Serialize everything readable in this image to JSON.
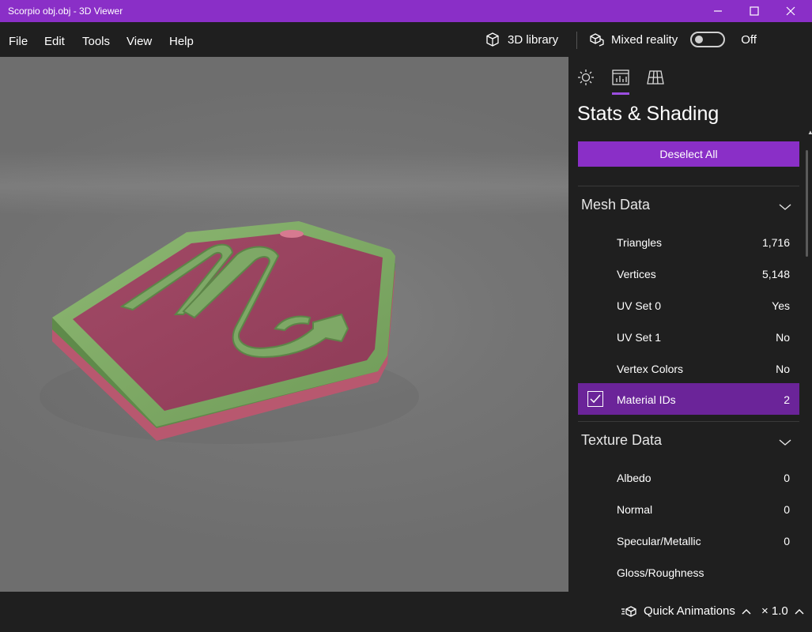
{
  "window": {
    "title": "Scorpio obj.obj - 3D Viewer",
    "accent_color": "#8a2fc7"
  },
  "menu": {
    "items": [
      {
        "label": "File"
      },
      {
        "label": "Edit"
      },
      {
        "label": "Tools"
      },
      {
        "label": "View"
      },
      {
        "label": "Help"
      }
    ],
    "library_label": "3D library",
    "library_icon": "cube-icon",
    "mixed_reality_label": "Mixed reality",
    "mixed_reality_icon": "mixed-reality-icon",
    "mixed_reality_state": "Off"
  },
  "viewport": {
    "model_name": "Scorpio obj.obj",
    "model_colors": {
      "frame": "#7da365",
      "plate": "#a04a66"
    }
  },
  "panel": {
    "tabs": [
      {
        "name": "lighting",
        "icon": "sun-icon",
        "active": false
      },
      {
        "name": "stats",
        "icon": "stats-chart-icon",
        "active": true
      },
      {
        "name": "grid",
        "icon": "grid-icon",
        "active": false
      }
    ],
    "title": "Stats & Shading",
    "deselect_label": "Deselect All",
    "mesh": {
      "heading": "Mesh Data",
      "rows": [
        {
          "label": "Triangles",
          "value": "1,716"
        },
        {
          "label": "Vertices",
          "value": "5,148"
        },
        {
          "label": "UV Set 0",
          "value": "Yes"
        },
        {
          "label": "UV Set 1",
          "value": "No"
        },
        {
          "label": "Vertex Colors",
          "value": "No"
        },
        {
          "label": "Material IDs",
          "value": "2",
          "selected": true
        }
      ]
    },
    "texture": {
      "heading": "Texture Data",
      "rows": [
        {
          "label": "Albedo",
          "value": "0"
        },
        {
          "label": "Normal",
          "value": "0"
        },
        {
          "label": "Specular/Metallic",
          "value": "0"
        },
        {
          "label": "Gloss/Roughness",
          "value": ""
        }
      ]
    }
  },
  "bottom": {
    "quick_animations_label": "Quick Animations",
    "speed_label": "× 1.0"
  }
}
